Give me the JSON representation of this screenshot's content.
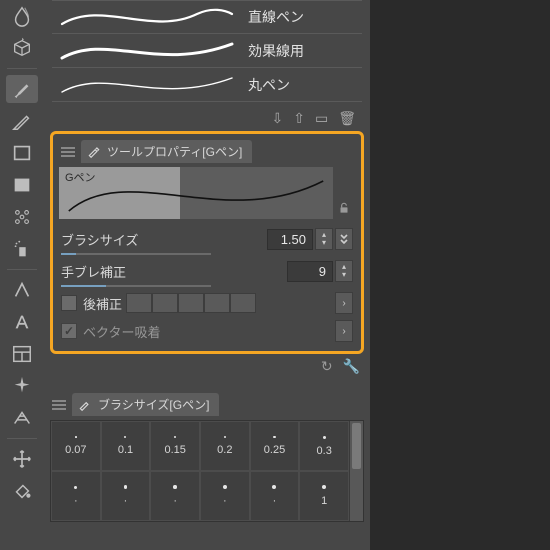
{
  "presets": {
    "items": [
      {
        "label": "直線ペン"
      },
      {
        "label": "効果線用"
      },
      {
        "label": "丸ペン"
      }
    ]
  },
  "toolProperty": {
    "panelTitle": "ツールプロパティ[Gペン]",
    "brushName": "Gペン",
    "brushSize": {
      "label": "ブラシサイズ",
      "value": "1.50"
    },
    "stabilization": {
      "label": "手ブレ補正",
      "value": "9"
    },
    "postCorrection": {
      "label": "後補正"
    },
    "vectorSnap": {
      "label": "ベクター吸着"
    }
  },
  "brushSizePanel": {
    "title": "ブラシサイズ[Gペン]",
    "sizes_row1": [
      "0.07",
      "0.1",
      "0.15",
      "0.2",
      "0.25",
      "0.3"
    ],
    "sizes_row2": [
      "·",
      "·",
      "·",
      "·",
      "·",
      "1"
    ]
  }
}
